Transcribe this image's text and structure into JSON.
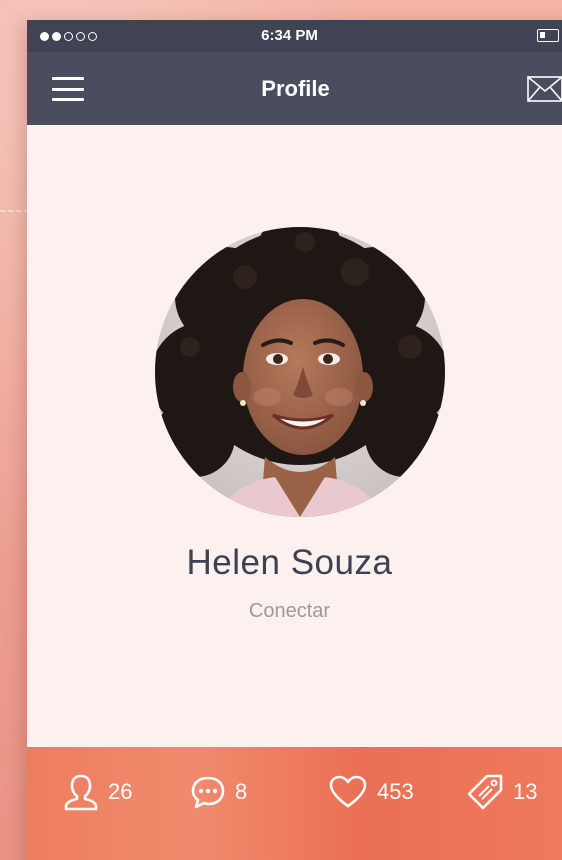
{
  "status_bar": {
    "signal": [
      true,
      true,
      false,
      false,
      false
    ],
    "time": "6:34 PM",
    "battery_icon": "battery-icon"
  },
  "nav": {
    "title": "Profile",
    "menu_icon": "hamburger-menu-icon",
    "mail_icon": "envelope-icon"
  },
  "profile": {
    "name": "Helen Souza",
    "action": "Conectar"
  },
  "stats": [
    {
      "icon": "user-icon",
      "value": "26"
    },
    {
      "icon": "chat-bubble-icon",
      "value": "8"
    },
    {
      "icon": "heart-icon",
      "value": "453"
    },
    {
      "icon": "tag-icon",
      "value": "13"
    }
  ],
  "colors": {
    "nav_bg": "#4a4d5e",
    "status_bg": "#3f4353",
    "content_bg": "#fdf1ef",
    "accent": "#ee7d5f",
    "name_text": "#3e4152",
    "secondary_text": "#9b9a9e"
  }
}
